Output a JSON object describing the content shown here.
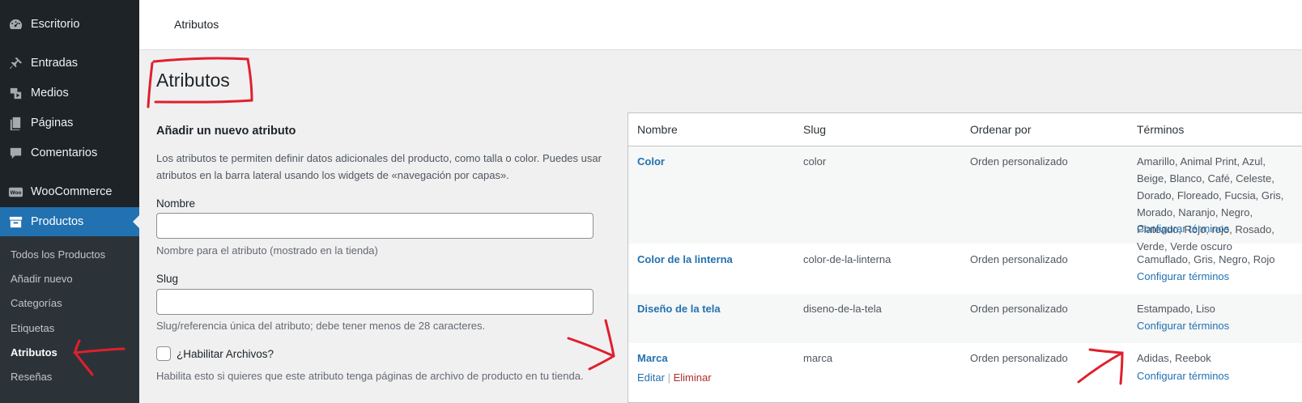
{
  "sidebar": {
    "items": [
      {
        "label": "Escritorio",
        "icon": "dashboard-icon"
      },
      {
        "label": "Entradas",
        "icon": "pin-icon"
      },
      {
        "label": "Medios",
        "icon": "media-icon"
      },
      {
        "label": "Páginas",
        "icon": "pages-icon"
      },
      {
        "label": "Comentarios",
        "icon": "comments-icon"
      },
      {
        "label": "WooCommerce",
        "icon": "woo-icon"
      },
      {
        "label": "Productos",
        "icon": "archive-icon"
      }
    ],
    "submenu": [
      "Todos los Productos",
      "Añadir nuevo",
      "Categorías",
      "Etiquetas",
      "Atributos",
      "Reseñas"
    ]
  },
  "header": {
    "title": "Atributos"
  },
  "page": {
    "title": "Atributos"
  },
  "form": {
    "heading": "Añadir un nuevo atributo",
    "description": "Los atributos te permiten definir datos adicionales del producto, como talla o color. Puedes usar atributos en la barra lateral usando los widgets de «navegación por capas».",
    "name_label": "Nombre",
    "name_help": "Nombre para el atributo (mostrado en la tienda)",
    "slug_label": "Slug",
    "slug_help": "Slug/referencia única del atributo; debe tener menos de 28 caracteres.",
    "archive_label": "¿Habilitar Archivos?",
    "archive_help": "Habilita esto si quieres que este atributo tenga páginas de archivo de producto en tu tienda."
  },
  "table": {
    "headers": [
      "Nombre",
      "Slug",
      "Ordenar por",
      "Términos"
    ],
    "rows": [
      {
        "name": "Color",
        "slug": "color",
        "order": "Orden personalizado",
        "terms": "Amarillo, Animal Print, Azul, Beige, Blanco, Café, Celeste, Dorado, Floreado, Fucsia, Gris, Morado, Naranjo, Negro, Plateado, Rojo, rojo, Rosado, Verde, Verde oscuro",
        "configure": "Configurar términos"
      },
      {
        "name": "Color de la linterna",
        "slug": "color-de-la-linterna",
        "order": "Orden personalizado",
        "terms": "Camuflado, Gris, Negro, Rojo",
        "configure": "Configurar términos"
      },
      {
        "name": "Diseño de la tela",
        "slug": "diseno-de-la-tela",
        "order": "Orden personalizado",
        "terms": "Estampado, Liso",
        "configure": "Configurar términos"
      },
      {
        "name": "Marca",
        "slug": "marca",
        "order": "Orden personalizado",
        "terms": "Adidas, Reebok",
        "configure": "Configurar términos",
        "edit": "Editar",
        "delete": "Eliminar"
      }
    ]
  },
  "colors": {
    "sidebar": "#1d2327",
    "submenu": "#2c3338",
    "accent": "#2271b1",
    "annotation": "#e01f2d",
    "delete": "#b32d2e"
  }
}
